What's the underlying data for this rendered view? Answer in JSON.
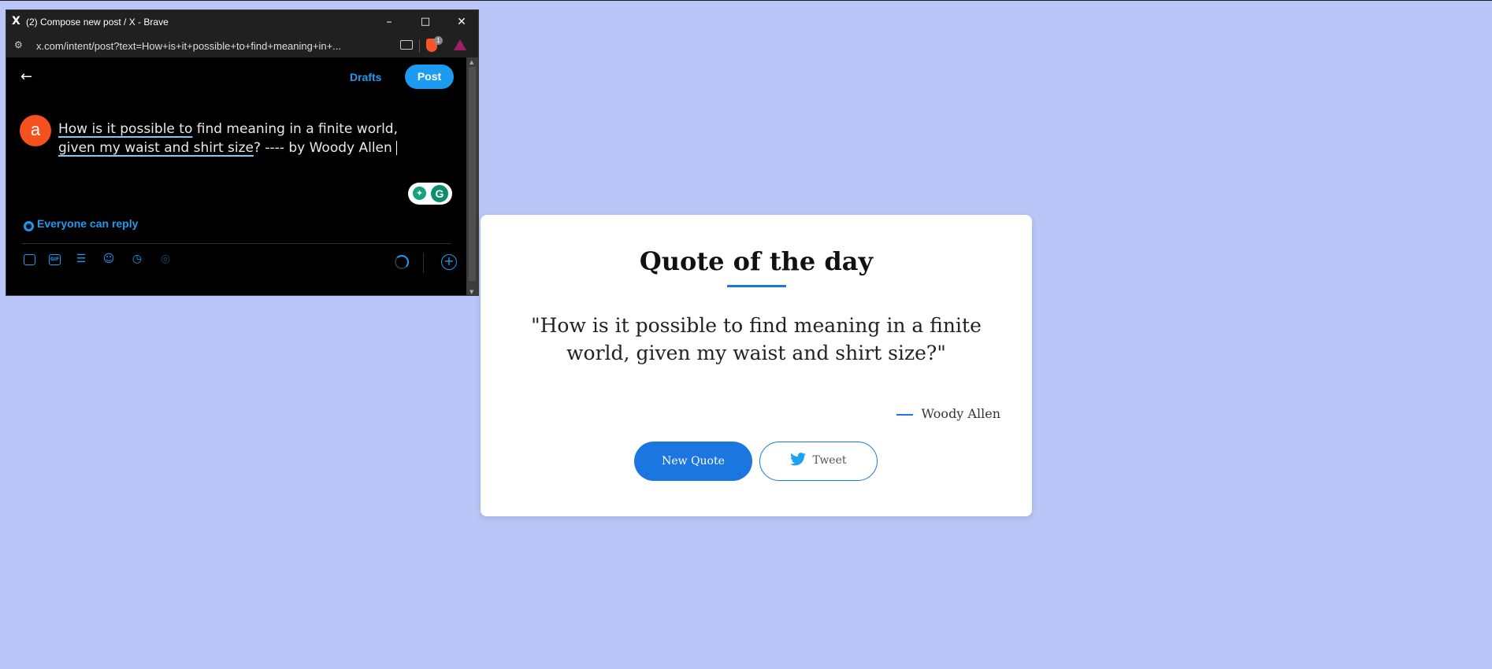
{
  "window": {
    "title": "(2) Compose new post / X - Brave",
    "logo": "X",
    "minimize": "–",
    "maximize": "□",
    "close": "✕",
    "url": "x.com/intent/post?text=How+is+it+possible+to+find+meaning+in+...",
    "brave_badge": "1"
  },
  "compose": {
    "back": "←",
    "drafts_label": "Drafts",
    "post_label": "Post",
    "avatar_letter": "a",
    "text_underlined_1": "How is it possible to",
    "text_plain_1": " find meaning in a finite world,",
    "text_underlined_2": "given my waist and shirt size",
    "text_plain_2": "? ---- by Woody Allen",
    "reply_setting": "Everyone can reply",
    "gif_label": "GIF"
  },
  "icons": {
    "colors": {
      "x_blue": "#1d9bf0",
      "grammarly": "#12a37f",
      "avatar": "#f4511e"
    }
  },
  "card": {
    "title": "Quote of the day",
    "quote": "\"How is it possible to find meaning in a finite world, given my waist and shirt size?\"",
    "author": "Woody Allen",
    "new_quote_label": "New Quote",
    "tweet_label": "Tweet",
    "accent": "#1b76e0"
  },
  "background": "#bac5f8"
}
